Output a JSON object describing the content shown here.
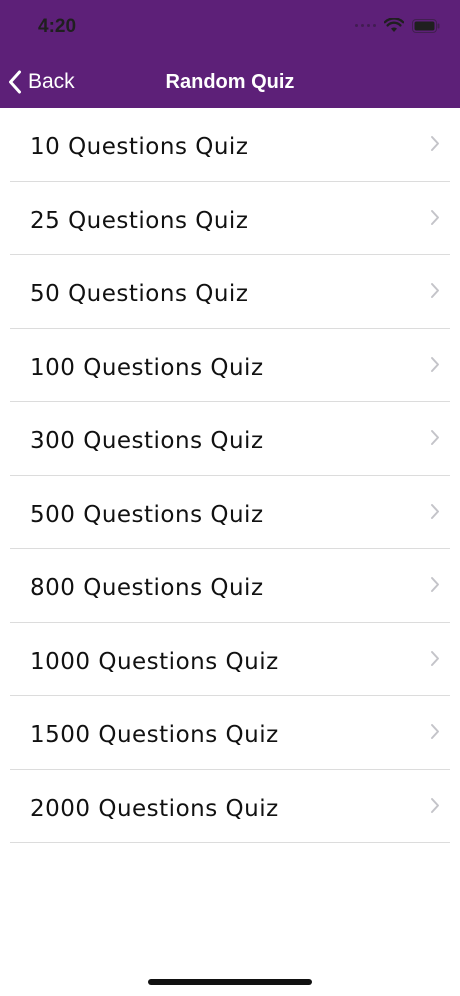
{
  "status_bar": {
    "time": "4:20",
    "icons": [
      "cellular-signal-icon",
      "wifi-icon",
      "battery-icon"
    ]
  },
  "nav": {
    "back_label": "Back",
    "title": "Random Quiz",
    "background_color": "#5d2078"
  },
  "quiz_items": [
    {
      "label": "10 Questions Quiz"
    },
    {
      "label": "25 Questions Quiz"
    },
    {
      "label": "50 Questions Quiz"
    },
    {
      "label": "100 Questions Quiz"
    },
    {
      "label": "300 Questions Quiz"
    },
    {
      "label": "500 Questions Quiz"
    },
    {
      "label": "800 Questions Quiz"
    },
    {
      "label": "1000 Questions Quiz"
    },
    {
      "label": "1500 Questions Quiz"
    },
    {
      "label": "2000 Questions Quiz"
    }
  ]
}
